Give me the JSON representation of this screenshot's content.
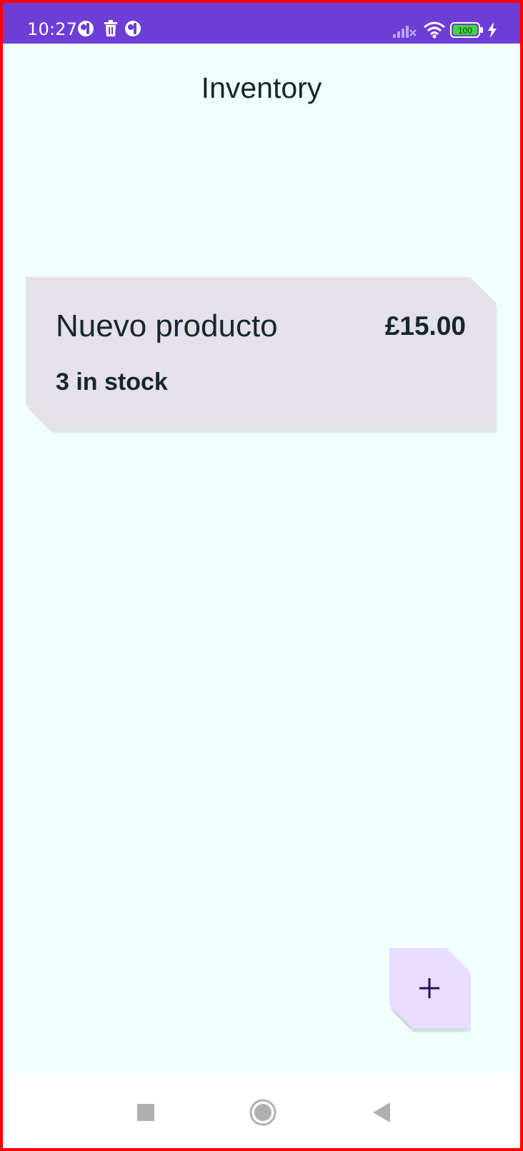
{
  "status_bar": {
    "time": "10:27",
    "battery_level": "100",
    "icons": [
      "notification-dot-icon",
      "trash-icon",
      "notification-dot-icon",
      "signal-icon",
      "wifi-icon",
      "battery-icon",
      "charging-icon"
    ],
    "background_color": "#6c3ed6"
  },
  "header": {
    "title": "Inventory"
  },
  "inventory": {
    "items": [
      {
        "name": "Nuevo producto",
        "price": "£15.00",
        "stock": "3 in stock"
      }
    ]
  },
  "fab": {
    "icon": "plus-icon",
    "color": "#e8dcff"
  },
  "navigation": {
    "buttons": [
      "recents-button",
      "home-button",
      "back-button"
    ]
  },
  "colors": {
    "background": "#f1ffff",
    "card": "#e6e0e8",
    "text": "#14272e"
  }
}
